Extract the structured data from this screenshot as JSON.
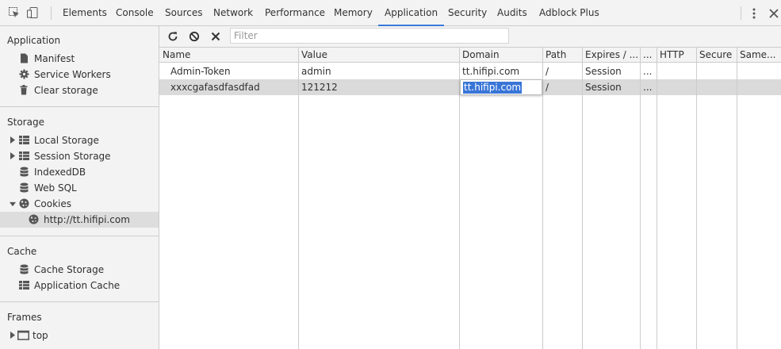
{
  "devtools": {
    "tabs": [
      "Elements",
      "Console",
      "Sources",
      "Network",
      "Performance",
      "Memory",
      "Application",
      "Security",
      "Audits",
      "Adblock Plus"
    ],
    "active_tab": "Application"
  },
  "sidebar": {
    "application": {
      "title": "Application",
      "items": [
        {
          "label": "Manifest",
          "icon": "document-icon"
        },
        {
          "label": "Service Workers",
          "icon": "gear-icon"
        },
        {
          "label": "Clear storage",
          "icon": "trash-icon"
        }
      ]
    },
    "storage": {
      "title": "Storage",
      "items": [
        {
          "label": "Local Storage",
          "icon": "grid-icon",
          "expandable": true
        },
        {
          "label": "Session Storage",
          "icon": "grid-icon",
          "expandable": true
        },
        {
          "label": "IndexedDB",
          "icon": "database-icon"
        },
        {
          "label": "Web SQL",
          "icon": "database-icon"
        },
        {
          "label": "Cookies",
          "icon": "cookie-icon",
          "expanded": true
        },
        {
          "label": "http://tt.hifipi.com",
          "icon": "cookie-icon",
          "selected": true
        }
      ]
    },
    "cache": {
      "title": "Cache",
      "items": [
        {
          "label": "Cache Storage",
          "icon": "database-icon"
        },
        {
          "label": "Application Cache",
          "icon": "grid-icon"
        }
      ]
    },
    "frames": {
      "title": "Frames",
      "items": [
        {
          "label": "top",
          "icon": "frame-icon",
          "expandable": true
        }
      ]
    }
  },
  "toolbar": {
    "filter_placeholder": "Filter",
    "icons": [
      "refresh-icon",
      "clear-icon",
      "delete-icon"
    ]
  },
  "cookies_table": {
    "columns": [
      "Name",
      "Value",
      "Domain",
      "Path",
      "Expires / ...",
      "...",
      "HTTP",
      "Secure",
      "Same..."
    ],
    "rows": [
      {
        "name": "Admin-Token",
        "value": "admin",
        "domain": "tt.hifipi.com",
        "path": "/",
        "expires": "Session",
        "size": "..."
      },
      {
        "name": "xxxcgafasdfasdfad",
        "value": "121212",
        "domain": "tt.hifipi.com",
        "path": "/",
        "expires": "Session",
        "size": "...",
        "selected": true,
        "editing_domain": true
      }
    ]
  },
  "colors": {
    "accent": "#3879d9",
    "selection": "#3875d7",
    "panel_bg": "#f3f3f3",
    "border": "#cccccc"
  }
}
